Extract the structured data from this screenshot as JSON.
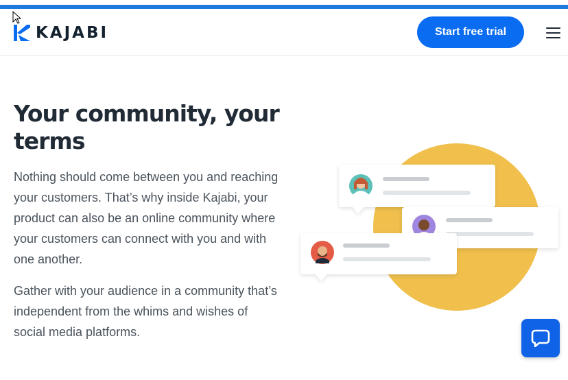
{
  "header": {
    "logo_text": "KAJABI",
    "cta_label": "Start free trial",
    "menu_icon": "hamburger-menu-icon"
  },
  "hero": {
    "title": "Your community, your terms",
    "paragraph_1": "Nothing should come between you and reaching your customers. That’s why inside Kajabi, your product can also be an online community where your customers can connect with you and with one another.",
    "paragraph_2": "Gather with your audience in a community that’s independent from the whims and wishes of social media platforms."
  },
  "chat_widget": {
    "icon": "chat-bubble-icon"
  },
  "colors": {
    "brand_blue": "#0a6cf0",
    "top_bar": "#1f7ae0",
    "circle_yellow": "#f0bf4c",
    "heading": "#212b36",
    "body_text": "#4a535c"
  }
}
